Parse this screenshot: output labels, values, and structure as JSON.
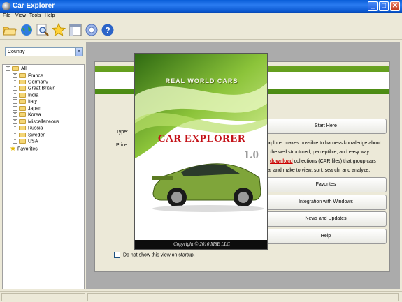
{
  "window": {
    "title": "Car Explorer",
    "controls": {
      "minimize": "_",
      "maximize": "□",
      "close": "✕"
    }
  },
  "menu": [
    "File",
    "View",
    "Tools",
    "Help"
  ],
  "toolbar": {
    "icons": [
      "open-folder-icon",
      "globe-icon",
      "search-icon",
      "star-icon",
      "layout-icon",
      "settings-icon",
      "help-icon"
    ]
  },
  "filter": {
    "selected": "Country"
  },
  "tree": {
    "root": "All",
    "countries": [
      "France",
      "Germany",
      "Great Britain",
      "India",
      "Italy",
      "Japan",
      "Korea",
      "Miscellaneous",
      "Russia",
      "Sweden",
      "USA"
    ],
    "favorites": "Favorites"
  },
  "panel": {
    "type_label": "Type:",
    "price_label": "Price:",
    "description_part1": "Explorer makes possible to harness knowledge about",
    "description_part2": "in the well structured, perceptible, and easy way.",
    "description_part3_pre": "ly",
    "download_link": "download",
    "description_part3_post": "collections (CAR files) that group cars",
    "description_part4": "ear and make to view, sort, search, and analyze.",
    "buttons": [
      "Start Here",
      "Favorites",
      "Integration with Windows",
      "News and Updates",
      "Help"
    ],
    "checkbox_label": "Do not show this view on startup."
  },
  "splash": {
    "tagline": "REAL WORLD CARS",
    "product": "CAR EXPLORER",
    "version": "1.0",
    "copyright": "Copyright © 2010 MSE LLC"
  },
  "colors": {
    "title_blue": "#0a58d0",
    "brand_red": "#c41218",
    "banner_green": "#5a9a1a",
    "car_green": "#7fa53a"
  }
}
